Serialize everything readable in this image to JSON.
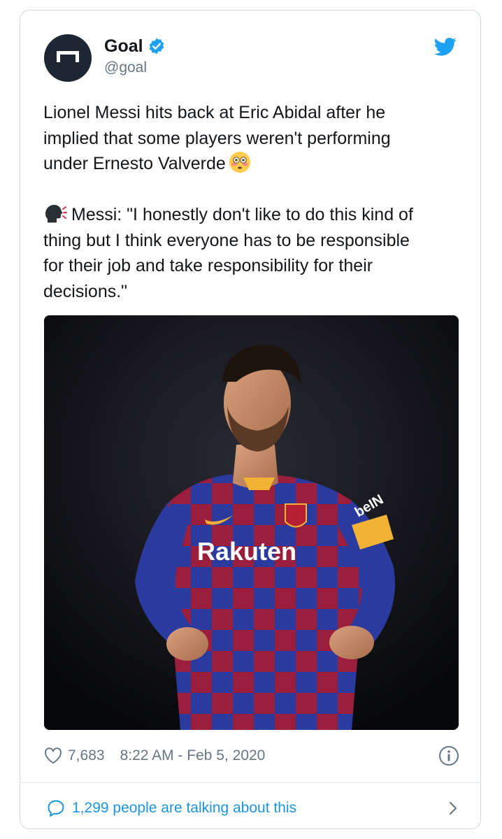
{
  "author": {
    "display_name": "Goal",
    "handle": "@goal",
    "verified": true
  },
  "tweet": {
    "line1": "Lionel Messi hits back at Eric Abidal after he",
    "line2": "implied that some players weren't performing",
    "line3": "under Ernesto Valverde",
    "emoji_1": "flushed-face-emoji",
    "emoji_2": "speaking-head-emoji",
    "quote_line1": "Messi: \"I honestly don't like to do this kind of",
    "quote_line2": "thing but I think everyone has to be responsible",
    "quote_line3": "for their job and take responsibility for their",
    "quote_line4": "decisions.\""
  },
  "media": {
    "sponsor_text": "Rakuten",
    "sleeve_text": "beIN"
  },
  "meta": {
    "likes": "7,683",
    "timestamp": "8:22 AM - Feb 5, 2020"
  },
  "conversation": {
    "label": "1,299 people are talking about this"
  },
  "colors": {
    "accent": "#1da1f2",
    "link": "#1b95e0",
    "muted": "#657786",
    "text": "#14171a",
    "border": "#cfd9de"
  }
}
